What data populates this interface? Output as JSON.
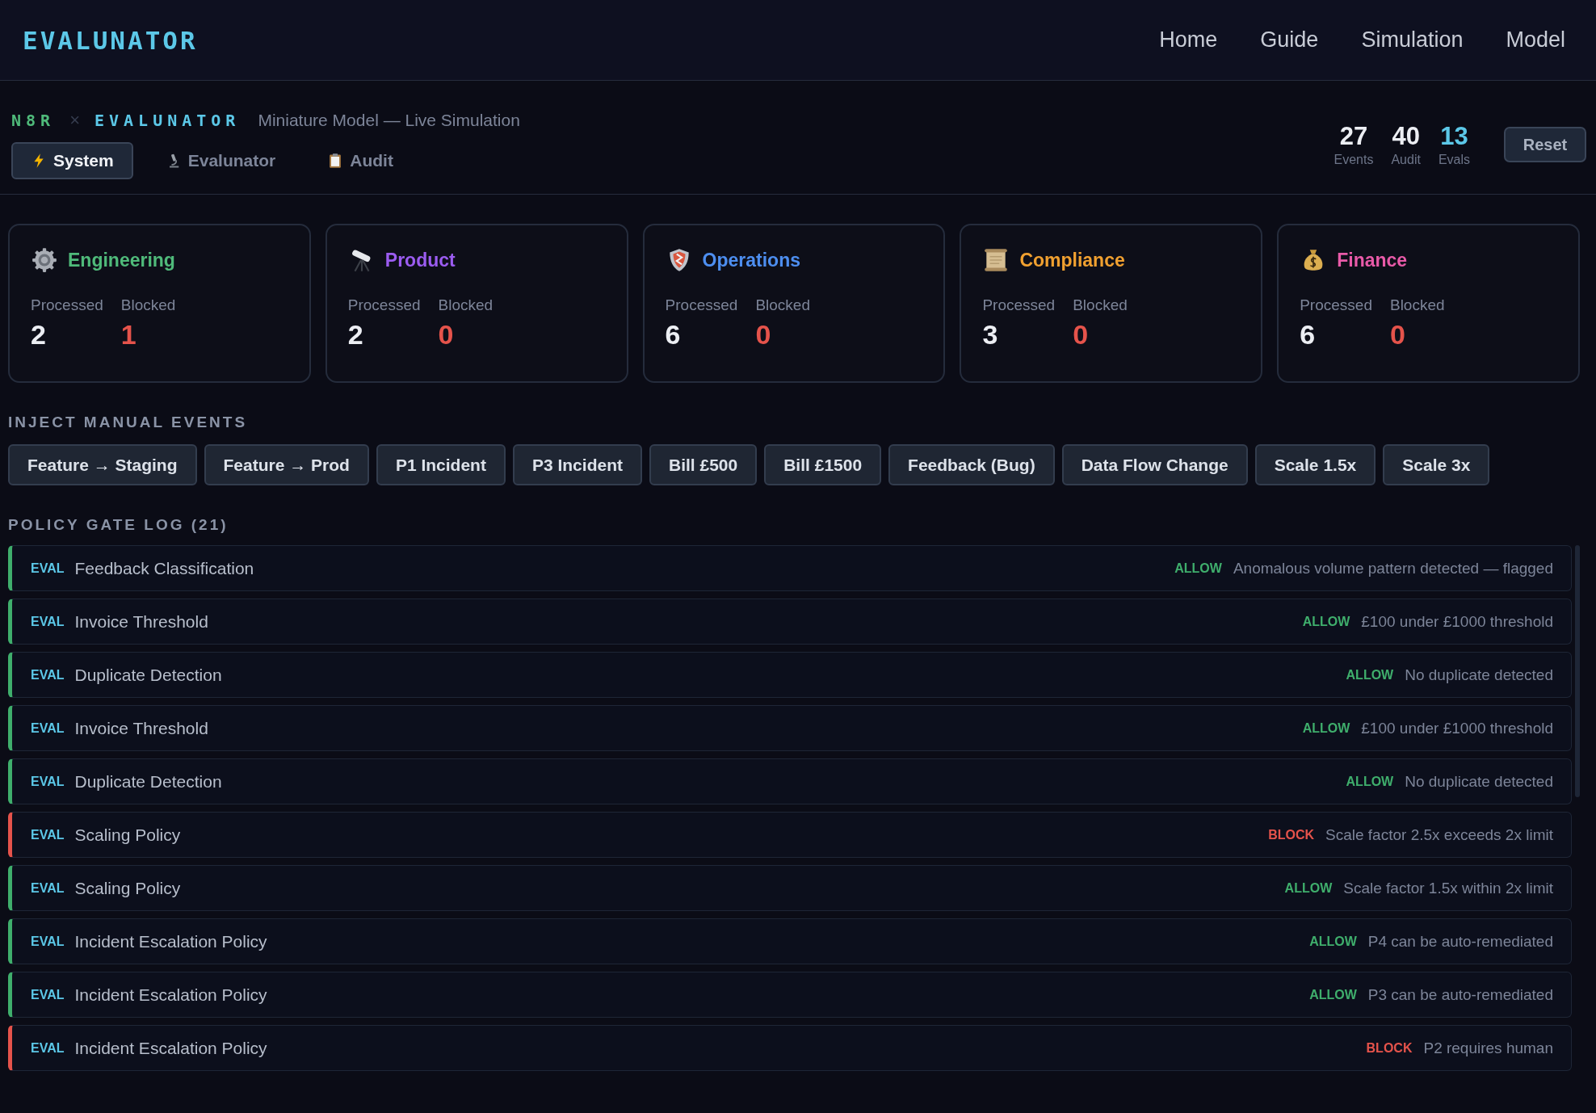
{
  "brand": "EVALUNATOR",
  "nav": [
    "Home",
    "Guide",
    "Simulation",
    "Model"
  ],
  "header": {
    "prefix": "N8R",
    "separator": "×",
    "title": "EVALUNATOR",
    "subtitle": "Miniature Model — Live Simulation"
  },
  "tabs": [
    {
      "label": "System",
      "selected": true
    },
    {
      "label": "Evalunator",
      "selected": false
    },
    {
      "label": "Audit",
      "selected": false
    }
  ],
  "stats": [
    {
      "value": "27",
      "label": "Events",
      "highlight": false
    },
    {
      "value": "40",
      "label": "Audit",
      "highlight": false
    },
    {
      "value": "13",
      "label": "Evals",
      "highlight": true
    }
  ],
  "reset_button": "Reset",
  "departments": [
    {
      "name": "Engineering",
      "color": "#4fba7a",
      "processed_label": "Processed",
      "processed": "2",
      "blocked_label": "Blocked",
      "blocked": "1"
    },
    {
      "name": "Product",
      "color": "#9b5cf0",
      "processed_label": "Processed",
      "processed": "2",
      "blocked_label": "Blocked",
      "blocked": "0"
    },
    {
      "name": "Operations",
      "color": "#4d8ef0",
      "processed_label": "Processed",
      "processed": "6",
      "blocked_label": "Blocked",
      "blocked": "0"
    },
    {
      "name": "Compliance",
      "color": "#f0a030",
      "processed_label": "Processed",
      "processed": "3",
      "blocked_label": "Blocked",
      "blocked": "0"
    },
    {
      "name": "Finance",
      "color": "#e85aa8",
      "processed_label": "Processed",
      "processed": "6",
      "blocked_label": "Blocked",
      "blocked": "0"
    }
  ],
  "inject_title": "INJECT MANUAL EVENTS",
  "inject_buttons": [
    "Feature → Staging",
    "Feature → Prod",
    "P1 Incident",
    "P3 Incident",
    "Bill £500",
    "Bill £1500",
    "Feedback (Bug)",
    "Data Flow Change",
    "Scale 1.5x",
    "Scale 3x"
  ],
  "log_title": "POLICY GATE LOG (21)",
  "log": [
    {
      "tag": "EVAL",
      "policy": "Feedback Classification",
      "decision": "ALLOW",
      "blocked": false,
      "reason": "Anomalous volume pattern detected — flagged"
    },
    {
      "tag": "EVAL",
      "policy": "Invoice Threshold",
      "decision": "ALLOW",
      "blocked": false,
      "reason": "£100 under £1000 threshold"
    },
    {
      "tag": "EVAL",
      "policy": "Duplicate Detection",
      "decision": "ALLOW",
      "blocked": false,
      "reason": "No duplicate detected"
    },
    {
      "tag": "EVAL",
      "policy": "Invoice Threshold",
      "decision": "ALLOW",
      "blocked": false,
      "reason": "£100 under £1000 threshold"
    },
    {
      "tag": "EVAL",
      "policy": "Duplicate Detection",
      "decision": "ALLOW",
      "blocked": false,
      "reason": "No duplicate detected"
    },
    {
      "tag": "EVAL",
      "policy": "Scaling Policy",
      "decision": "BLOCK",
      "blocked": true,
      "reason": "Scale factor 2.5x exceeds 2x limit"
    },
    {
      "tag": "EVAL",
      "policy": "Scaling Policy",
      "decision": "ALLOW",
      "blocked": false,
      "reason": "Scale factor 1.5x within 2x limit"
    },
    {
      "tag": "EVAL",
      "policy": "Incident Escalation Policy",
      "decision": "ALLOW",
      "blocked": false,
      "reason": "P4 can be auto-remediated"
    },
    {
      "tag": "EVAL",
      "policy": "Incident Escalation Policy",
      "decision": "ALLOW",
      "blocked": false,
      "reason": "P3 can be auto-remediated"
    },
    {
      "tag": "EVAL",
      "policy": "Incident Escalation Policy",
      "decision": "BLOCK",
      "blocked": true,
      "reason": "P2 requires human"
    }
  ]
}
